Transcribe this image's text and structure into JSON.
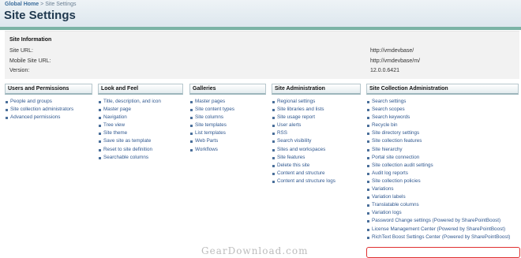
{
  "breadcrumb": {
    "home": "Global Home",
    "sep": ">",
    "current": "Site Settings"
  },
  "page_title": "Site Settings",
  "site_info": {
    "title": "Site Information",
    "rows": [
      {
        "label": "Site URL:",
        "value": "http://vmdevbase/"
      },
      {
        "label": "Mobile Site URL:",
        "value": "http://vmdevbase/m/"
      },
      {
        "label": "Version:",
        "value": "12.0.0.6421"
      }
    ]
  },
  "sections": [
    {
      "title": "Users and Permissions",
      "links": [
        "People and groups",
        "Site collection administrators",
        "Advanced permissions"
      ]
    },
    {
      "title": "Look and Feel",
      "links": [
        "Title, description, and icon",
        "Master page",
        "Navigation",
        "Tree view",
        "Site theme",
        "Save site as template",
        "Reset to site definition",
        "Searchable columns"
      ]
    },
    {
      "title": "Galleries",
      "links": [
        "Master pages",
        "Site content types",
        "Site columns",
        "Site templates",
        "List templates",
        "Web Parts",
        "Workflows"
      ]
    },
    {
      "title": "Site Administration",
      "links": [
        "Regional settings",
        "Site libraries and lists",
        "Site usage report",
        "User alerts",
        "RSS",
        "Search visibility",
        "Sites and workspaces",
        "Site features",
        "Delete this site",
        "Content and structure",
        "Content and structure logs"
      ]
    },
    {
      "title": "Site Collection Administration",
      "links": [
        "Search settings",
        "Search scopes",
        "Search keywords",
        "Recycle bin",
        "Site directory settings",
        "Site collection features",
        "Site hierarchy",
        "Portal site connection",
        "Site collection audit settings",
        "Audit log reports",
        "Site collection policies",
        "Variations",
        "Variation labels",
        "Translatable columns",
        "Variation logs",
        "Password Change settings (Powered by SharePointBoost)",
        "License Management Center (Powered by SharePointBoost)",
        "RichText Boost Settings Center (Powered by SharePointBoost)"
      ]
    }
  ],
  "watermark": "GearDownload.com",
  "colors": {
    "accent_bar": "#7bb3a5",
    "link": "#30588f",
    "highlight": "#e03030"
  }
}
